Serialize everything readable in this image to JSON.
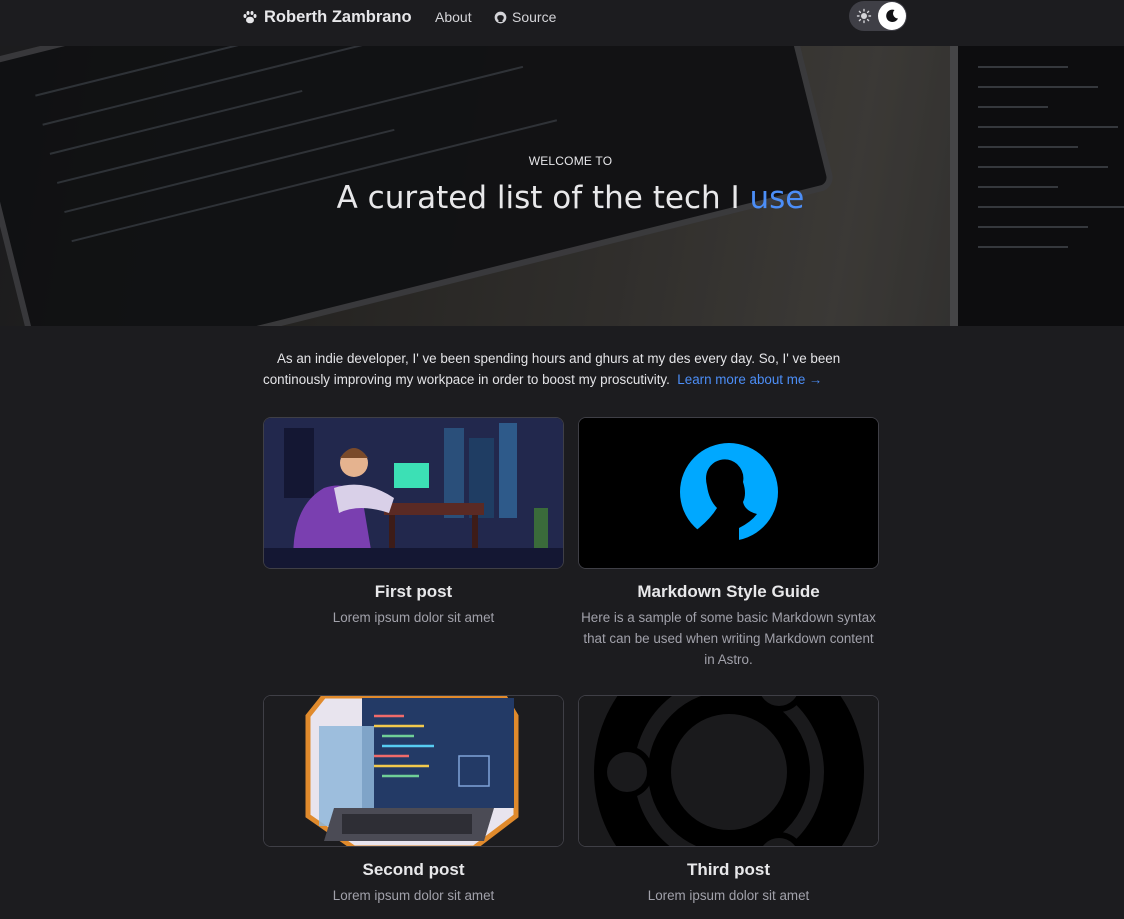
{
  "nav": {
    "brand": "Roberth Zambrano",
    "about": "About",
    "source": "Source"
  },
  "hero": {
    "kicker": "WELCOME TO",
    "title_main": "A curated list of the tech I",
    "title_accent": "use"
  },
  "intro": {
    "text": "As an indie developer, I' ve been spending hours and ghurs at my des every day. So, I' ve been continously improving my workpace in order to boost my proscutivity.",
    "link": "Learn more about me →"
  },
  "posts": [
    {
      "title": "First post",
      "description": "Lorem ipsum dolor sit amet"
    },
    {
      "title": "Markdown Style Guide",
      "description": "Here is a sample of some basic Markdown syntax that can be used when writing Markdown content in Astro."
    },
    {
      "title": "Second post",
      "description": "Lorem ipsum dolor sit amet"
    },
    {
      "title": "Third post",
      "description": "Lorem ipsum dolor sit amet"
    }
  ],
  "colors": {
    "background": "#1c1c1f",
    "accent": "#4c8ef7",
    "avatar_blue": "#00a8ff"
  }
}
